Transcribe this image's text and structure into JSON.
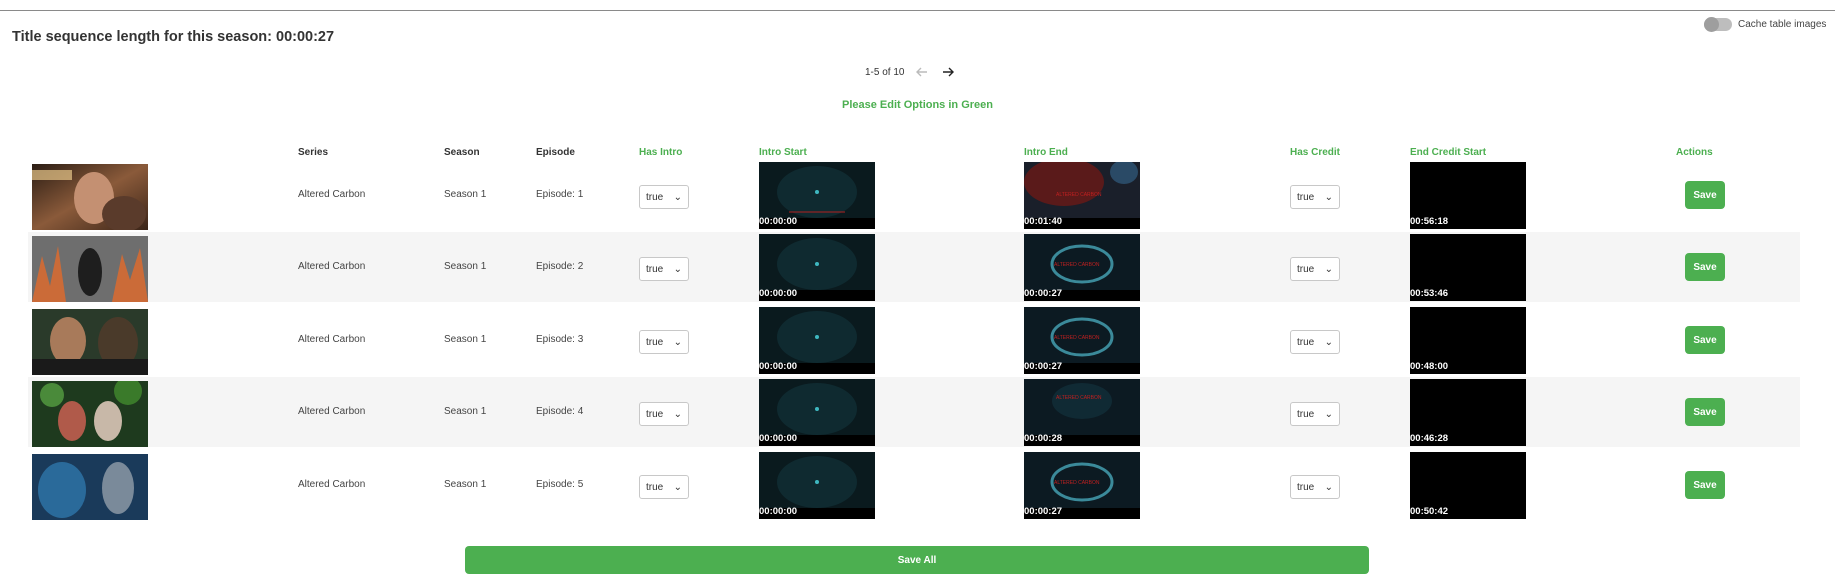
{
  "header": {
    "title": "Title sequence length for this season: 00:00:27",
    "cache_toggle_label": "Cache table images",
    "cache_toggle_on": false,
    "pagination": "1-5 of 10",
    "edit_note": "Please Edit Options in Green"
  },
  "columns": {
    "series": "Series",
    "season": "Season",
    "episode": "Episode",
    "has_intro": "Has Intro",
    "intro_start": "Intro Start",
    "intro_end": "Intro End",
    "has_credit": "Has Credit",
    "end_credit_start": "End Credit Start",
    "actions": "Actions"
  },
  "rows": [
    {
      "series": "Altered Carbon",
      "season": "Season 1",
      "episode": "Episode: 1",
      "has_intro": "true",
      "intro_start": "00:00:00",
      "intro_end": "00:01:40",
      "has_credit": "true",
      "end_credit_start": "00:56:18",
      "action": "Save"
    },
    {
      "series": "Altered Carbon",
      "season": "Season 1",
      "episode": "Episode: 2",
      "has_intro": "true",
      "intro_start": "00:00:00",
      "intro_end": "00:00:27",
      "has_credit": "true",
      "end_credit_start": "00:53:46",
      "action": "Save"
    },
    {
      "series": "Altered Carbon",
      "season": "Season 1",
      "episode": "Episode: 3",
      "has_intro": "true",
      "intro_start": "00:00:00",
      "intro_end": "00:00:27",
      "has_credit": "true",
      "end_credit_start": "00:48:00",
      "action": "Save"
    },
    {
      "series": "Altered Carbon",
      "season": "Season 1",
      "episode": "Episode: 4",
      "has_intro": "true",
      "intro_start": "00:00:00",
      "intro_end": "00:00:28",
      "has_credit": "true",
      "end_credit_start": "00:46:28",
      "action": "Save"
    },
    {
      "series": "Altered Carbon",
      "season": "Season 1",
      "episode": "Episode: 5",
      "has_intro": "true",
      "intro_start": "00:00:00",
      "intro_end": "00:00:27",
      "has_credit": "true",
      "end_credit_start": "00:50:42",
      "action": "Save"
    }
  ],
  "save_all_label": "Save All",
  "colors": {
    "accent_green": "#4caf50",
    "row_alt": "#f5f5f5",
    "frame_bg": "#000000"
  },
  "icons": {
    "prev": "arrow-left-icon",
    "next": "arrow-right-icon",
    "select": "chevron-down-icon"
  }
}
